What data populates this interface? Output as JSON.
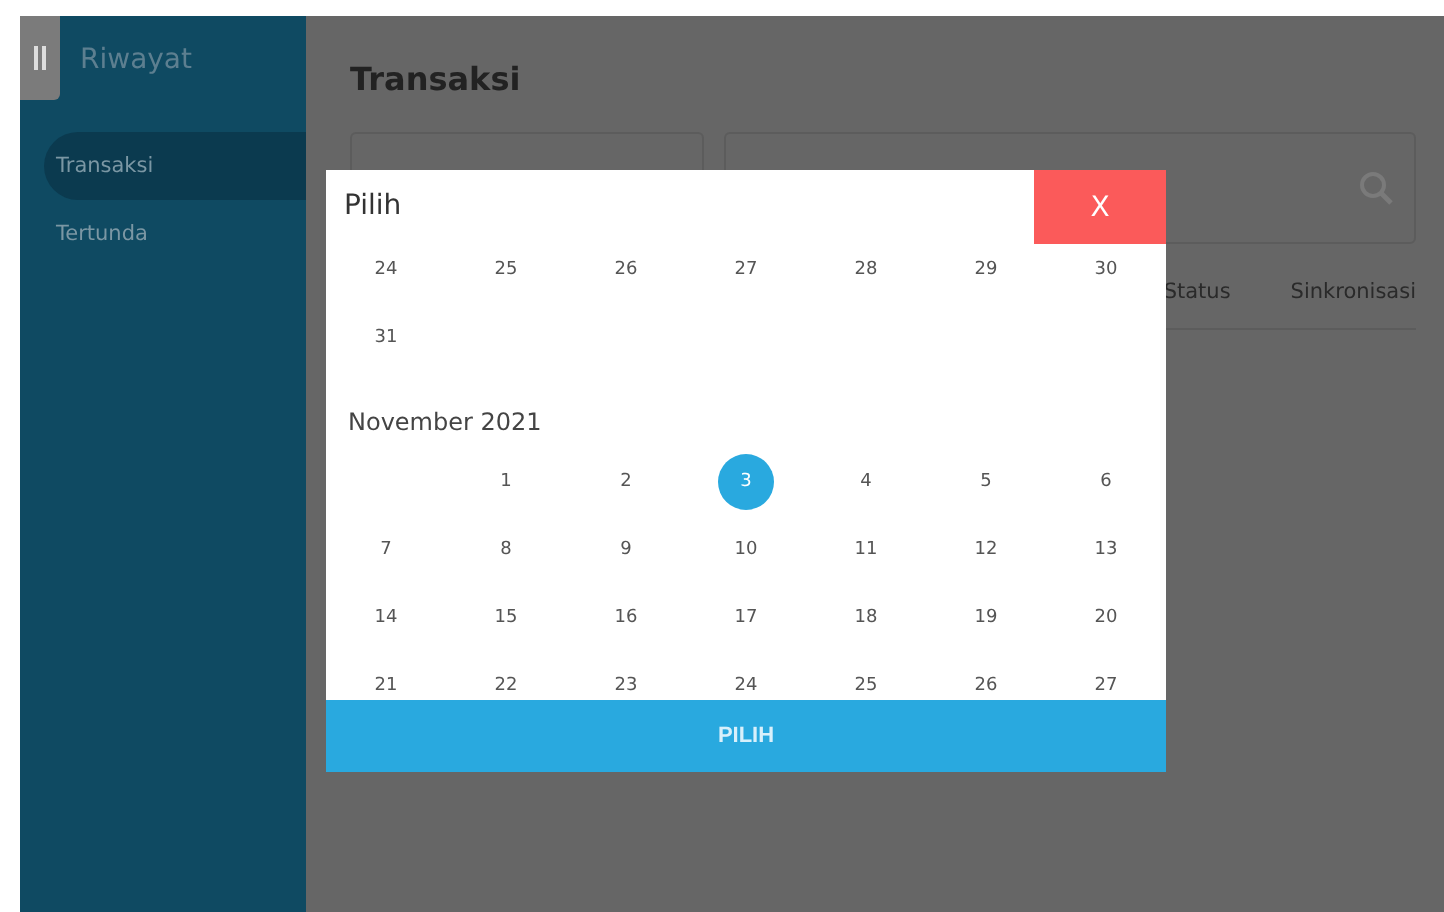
{
  "sidebar": {
    "title": "Riwayat",
    "items": [
      {
        "label": "Transaksi",
        "selected": true
      },
      {
        "label": "Tertunda",
        "selected": false
      }
    ]
  },
  "page": {
    "title": "Transaksi",
    "table": {
      "columns": [
        "Status",
        "Sinkronisasi"
      ]
    }
  },
  "dialog": {
    "title": "Pilih",
    "close": "X",
    "button": "PILIH",
    "sections": [
      {
        "weeks": [
          {
            "kind": "regular",
            "days": [
              {
                "day": "24",
                "selected": false
              },
              {
                "day": "25",
                "selected": false
              },
              {
                "day": "26",
                "selected": false
              },
              {
                "day": "27",
                "selected": false
              },
              {
                "day": "28",
                "selected": false
              },
              {
                "day": "29",
                "selected": false
              },
              {
                "day": "30",
                "selected": false
              }
            ]
          },
          {
            "kind": "regular",
            "days": [
              {
                "day": "31",
                "selected": false
              }
            ]
          }
        ]
      },
      {
        "month": "November 2021",
        "weeks": [
          {
            "kind": "opening",
            "days": [
              {
                "day": "1",
                "selected": false
              },
              {
                "day": "2",
                "selected": false
              },
              {
                "day": "3",
                "selected": true
              },
              {
                "day": "4",
                "selected": false
              },
              {
                "day": "5",
                "selected": false
              },
              {
                "day": "6",
                "selected": false
              }
            ]
          },
          {
            "kind": "regular",
            "days": [
              {
                "day": "7",
                "selected": false
              },
              {
                "day": "8",
                "selected": false
              },
              {
                "day": "9",
                "selected": false
              },
              {
                "day": "10",
                "selected": false
              },
              {
                "day": "11",
                "selected": false
              },
              {
                "day": "12",
                "selected": false
              },
              {
                "day": "13",
                "selected": false
              }
            ]
          },
          {
            "kind": "regular",
            "days": [
              {
                "day": "14",
                "selected": false
              },
              {
                "day": "15",
                "selected": false
              },
              {
                "day": "16",
                "selected": false
              },
              {
                "day": "17",
                "selected": false
              },
              {
                "day": "18",
                "selected": false
              },
              {
                "day": "19",
                "selected": false
              },
              {
                "day": "20",
                "selected": false
              }
            ]
          },
          {
            "kind": "regular",
            "days": [
              {
                "day": "21",
                "selected": false
              },
              {
                "day": "22",
                "selected": false
              },
              {
                "day": "23",
                "selected": false
              },
              {
                "day": "24",
                "selected": false
              },
              {
                "day": "25",
                "selected": false
              },
              {
                "day": "26",
                "selected": false
              },
              {
                "day": "27",
                "selected": false
              }
            ]
          }
        ]
      }
    ]
  }
}
